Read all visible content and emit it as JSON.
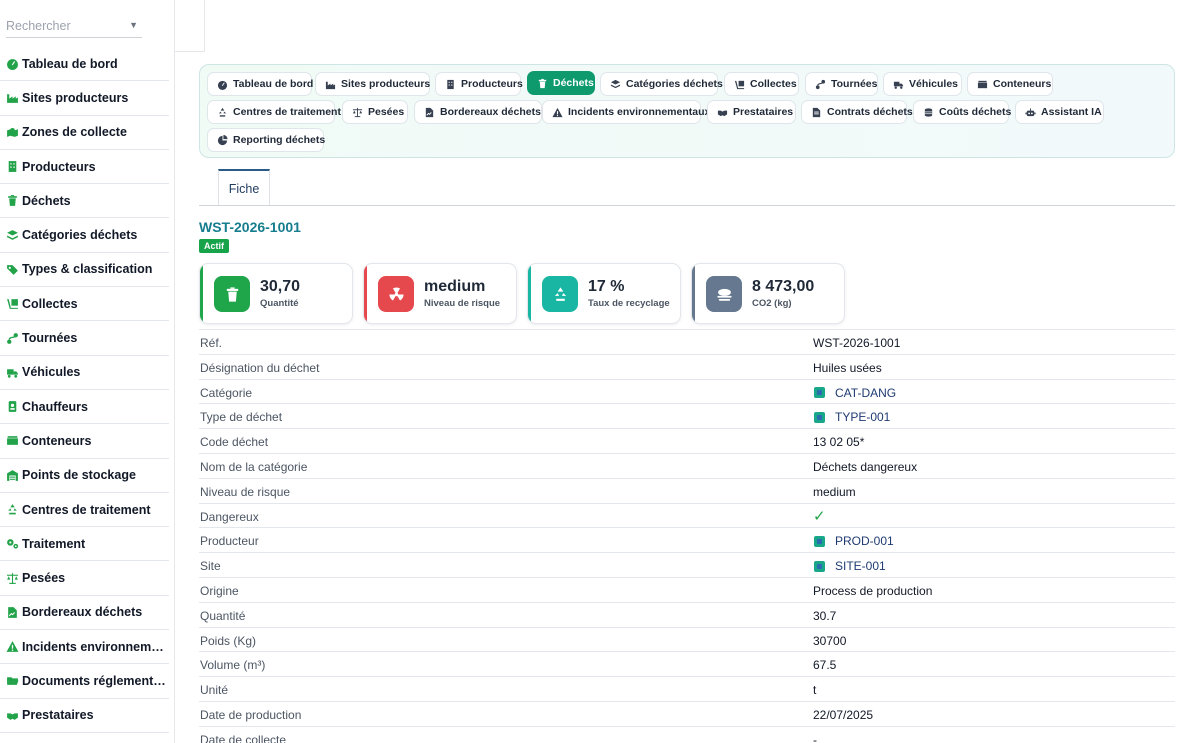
{
  "sidebar": {
    "search_placeholder": "Rechercher",
    "items": [
      {
        "label": "Tableau de bord",
        "icon": "gauge-icon"
      },
      {
        "label": "Sites producteurs",
        "icon": "industry-icon"
      },
      {
        "label": "Zones de collecte",
        "icon": "map-marked-icon"
      },
      {
        "label": "Producteurs",
        "icon": "building-icon"
      },
      {
        "label": "Déchets",
        "icon": "trash-icon"
      },
      {
        "label": "Catégories déchets",
        "icon": "layers-icon"
      },
      {
        "label": "Types & classification",
        "icon": "tags-icon"
      },
      {
        "label": "Collectes",
        "icon": "dolly-icon"
      },
      {
        "label": "Tournées",
        "icon": "route-icon"
      },
      {
        "label": "Véhicules",
        "icon": "truck-icon"
      },
      {
        "label": "Chauffeurs",
        "icon": "id-badge-icon"
      },
      {
        "label": "Conteneurs",
        "icon": "dumpster-icon"
      },
      {
        "label": "Points de stockage",
        "icon": "warehouse-icon"
      },
      {
        "label": "Centres de traitement",
        "icon": "recycle-icon"
      },
      {
        "label": "Traitement",
        "icon": "cogs-icon"
      },
      {
        "label": "Pesées",
        "icon": "balance-scale-icon"
      },
      {
        "label": "Bordereaux déchets",
        "icon": "file-signature-icon"
      },
      {
        "label": "Incidents environnementaux",
        "icon": "warning-icon"
      },
      {
        "label": "Documents réglementaires",
        "icon": "folder-open-icon"
      },
      {
        "label": "Prestataires",
        "icon": "handshake-icon"
      }
    ]
  },
  "tabs": [
    {
      "label": "Tableau de bord",
      "icon": "gauge-icon",
      "active": false
    },
    {
      "label": "Sites producteurs",
      "icon": "industry-icon",
      "active": false
    },
    {
      "label": "Producteurs",
      "icon": "building-icon",
      "active": false
    },
    {
      "label": "Déchets",
      "icon": "trash-icon",
      "active": true
    },
    {
      "label": "Catégories déchets",
      "icon": "layers-icon",
      "active": false
    },
    {
      "label": "Collectes",
      "icon": "dolly-icon",
      "active": false
    },
    {
      "label": "Tournées",
      "icon": "route-icon",
      "active": false
    },
    {
      "label": "Véhicules",
      "icon": "truck-icon",
      "active": false
    },
    {
      "label": "Conteneurs",
      "icon": "dumpster-icon",
      "active": false
    },
    {
      "label": "Centres de traitement",
      "icon": "recycle-icon",
      "active": false
    },
    {
      "label": "Pesées",
      "icon": "balance-scale-icon",
      "active": false
    },
    {
      "label": "Bordereaux déchets",
      "icon": "file-signature-icon",
      "active": false
    },
    {
      "label": "Incidents environnementaux",
      "icon": "warning-icon",
      "active": false
    },
    {
      "label": "Prestataires",
      "icon": "handshake-icon",
      "active": false
    },
    {
      "label": "Contrats déchets",
      "icon": "file-contract-icon",
      "active": false
    },
    {
      "label": "Coûts déchets",
      "icon": "coins-icon",
      "active": false
    },
    {
      "label": "Assistant IA",
      "icon": "robot-icon",
      "active": false
    },
    {
      "label": "Reporting déchets",
      "icon": "chart-pie-icon",
      "active": false
    }
  ],
  "fiche_tab": "Fiche",
  "record": {
    "title": "WST-2026-1001",
    "status": "Actif"
  },
  "kpis": [
    {
      "value": "30,70",
      "label": "Quantité",
      "icon": "trash-icon",
      "color": "#1fa64a"
    },
    {
      "value": "medium",
      "label": "Niveau de risque",
      "icon": "radiation-icon",
      "color": "#e5484d"
    },
    {
      "value": "17 %",
      "label": "Taux de recyclage",
      "icon": "recycle-icon",
      "color": "#1ab6a4"
    },
    {
      "value": "8 473,00",
      "label": "CO2 (kg)",
      "icon": "smog-icon",
      "color": "#66788f"
    }
  ],
  "details": [
    {
      "key": "Réf.",
      "value": "WST-2026-1001",
      "type": "text"
    },
    {
      "key": "Désignation du déchet",
      "value": "Huiles usées",
      "type": "text"
    },
    {
      "key": "Catégorie",
      "value": "CAT-DANG",
      "type": "link"
    },
    {
      "key": "Type de déchet",
      "value": "TYPE-001",
      "type": "link"
    },
    {
      "key": "Code déchet",
      "value": "13 02 05*",
      "type": "text"
    },
    {
      "key": "Nom de la catégorie",
      "value": "Déchets dangereux",
      "type": "text"
    },
    {
      "key": "Niveau de risque",
      "value": "medium",
      "type": "text"
    },
    {
      "key": "Dangereux",
      "value": "✓",
      "type": "check"
    },
    {
      "key": "Producteur",
      "value": "PROD-001",
      "type": "link"
    },
    {
      "key": "Site",
      "value": "SITE-001",
      "type": "link"
    },
    {
      "key": "Origine",
      "value": "Process de production",
      "type": "text"
    },
    {
      "key": "Quantité",
      "value": "30.7",
      "type": "text"
    },
    {
      "key": "Poids (Kg)",
      "value": "30700",
      "type": "text"
    },
    {
      "key": "Volume (m³)",
      "value": "67.5",
      "type": "text"
    },
    {
      "key": "Unité",
      "value": "t",
      "type": "text"
    },
    {
      "key": "Date de production",
      "value": "22/07/2025",
      "type": "text"
    },
    {
      "key": "Date de collecte",
      "value": "-",
      "type": "text"
    }
  ],
  "colors": {
    "accent": "#0e9a6c",
    "sidebar_icon": "#22a34a",
    "title": "#167d8e",
    "status": "#16a34a"
  }
}
